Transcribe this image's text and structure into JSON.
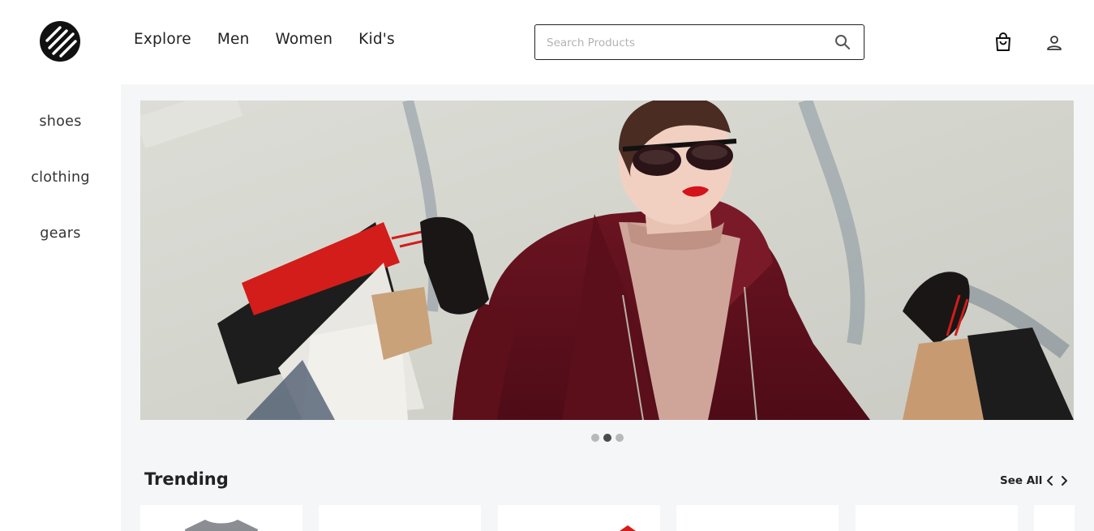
{
  "header": {
    "nav": [
      {
        "label": "Explore"
      },
      {
        "label": "Men"
      },
      {
        "label": "Women"
      },
      {
        "label": "Kid's"
      }
    ],
    "search": {
      "placeholder": "Search Products",
      "value": "",
      "icon": "search-icon"
    },
    "icons": {
      "cart": "shopping-bag-icon",
      "account": "user-icon"
    }
  },
  "sidebar": {
    "items": [
      {
        "label": "shoes"
      },
      {
        "label": "clothing"
      },
      {
        "label": "gears"
      }
    ]
  },
  "carousel": {
    "slide_count": 3,
    "active_index": 1
  },
  "trending": {
    "title": "Trending",
    "see_all_label": "See All",
    "visible_cards": 6
  },
  "colors": {
    "background": "#f5f6f8",
    "accent_dark": "#222222",
    "hero_coat": "#6b1421",
    "lipstick_red": "#d4131a"
  }
}
